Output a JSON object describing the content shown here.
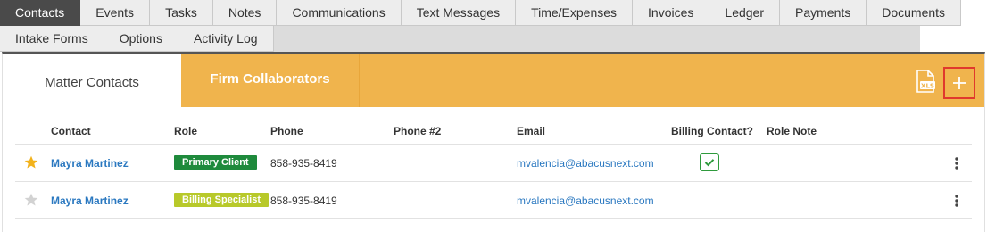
{
  "top_tabs": {
    "row1": [
      "Contacts",
      "Events",
      "Tasks",
      "Notes",
      "Communications",
      "Text Messages",
      "Time/Expenses",
      "Invoices",
      "Ledger",
      "Payments",
      "Documents"
    ],
    "row2": [
      "Intake Forms",
      "Options",
      "Activity Log"
    ],
    "active": "Contacts"
  },
  "subtabs": {
    "matter": "Matter Contacts",
    "firm": "Firm Collaborators"
  },
  "toolbar": {
    "export_icon": "xls-file-icon",
    "add_icon": "plus-icon"
  },
  "table": {
    "headers": {
      "contact": "Contact",
      "role": "Role",
      "phone": "Phone",
      "phone2": "Phone #2",
      "email": "Email",
      "billing": "Billing Contact?",
      "role_note": "Role Note"
    },
    "rows": [
      {
        "starred": true,
        "contact": "Mayra Martinez",
        "role": "Primary Client",
        "role_color": "#1e8a3c",
        "phone": "858-935-8419",
        "phone2": "",
        "email": "mvalencia@abacusnext.com",
        "billing": true,
        "role_note": ""
      },
      {
        "starred": false,
        "contact": "Mayra Martinez",
        "role": "Billing Specialist",
        "role_color": "#b8c92a",
        "phone": "858-935-8419",
        "phone2": "",
        "email": "mvalencia@abacusnext.com",
        "billing": false,
        "role_note": ""
      }
    ]
  },
  "colors": {
    "accent": "#f0b44d",
    "active_tab": "#4a4a4a",
    "link": "#2a78c0",
    "add_highlight": "#e0392d"
  }
}
